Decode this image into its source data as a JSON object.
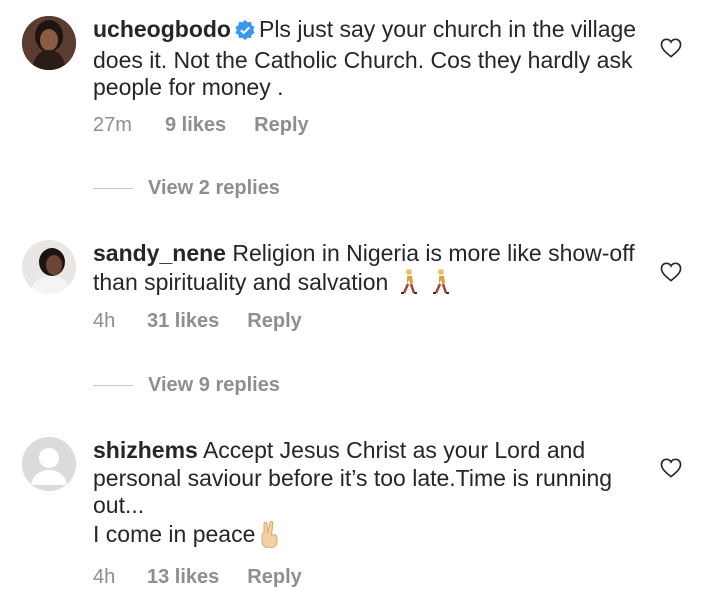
{
  "comments": [
    {
      "username": "ucheogbodo",
      "verified": true,
      "text": "Pls just say your church in the village does it. Not the Catholic Church. Cos they hardly ask people for money .",
      "time": "27m",
      "likes": "9 likes",
      "reply": "Reply",
      "view_replies": "View 2 replies"
    },
    {
      "username": "sandy_nene",
      "verified": false,
      "text": "Religion in Nigeria is more like show-off than spirituality and salvation",
      "emoji": "person-walking-emoji",
      "time": "4h",
      "likes": "31 likes",
      "reply": "Reply",
      "view_replies": "View 9 replies"
    },
    {
      "username": "shizhems",
      "verified": false,
      "text": "Accept Jesus Christ as your Lord and personal saviour before it’s too late.Time is running out...",
      "text2": "I come in peace",
      "emoji": "victory-hand-emoji",
      "time": "4h",
      "likes": "13 likes",
      "reply": "Reply"
    }
  ],
  "colors": {
    "text": "#262626",
    "meta": "#8e8e8e",
    "verified": "#3897f0"
  }
}
